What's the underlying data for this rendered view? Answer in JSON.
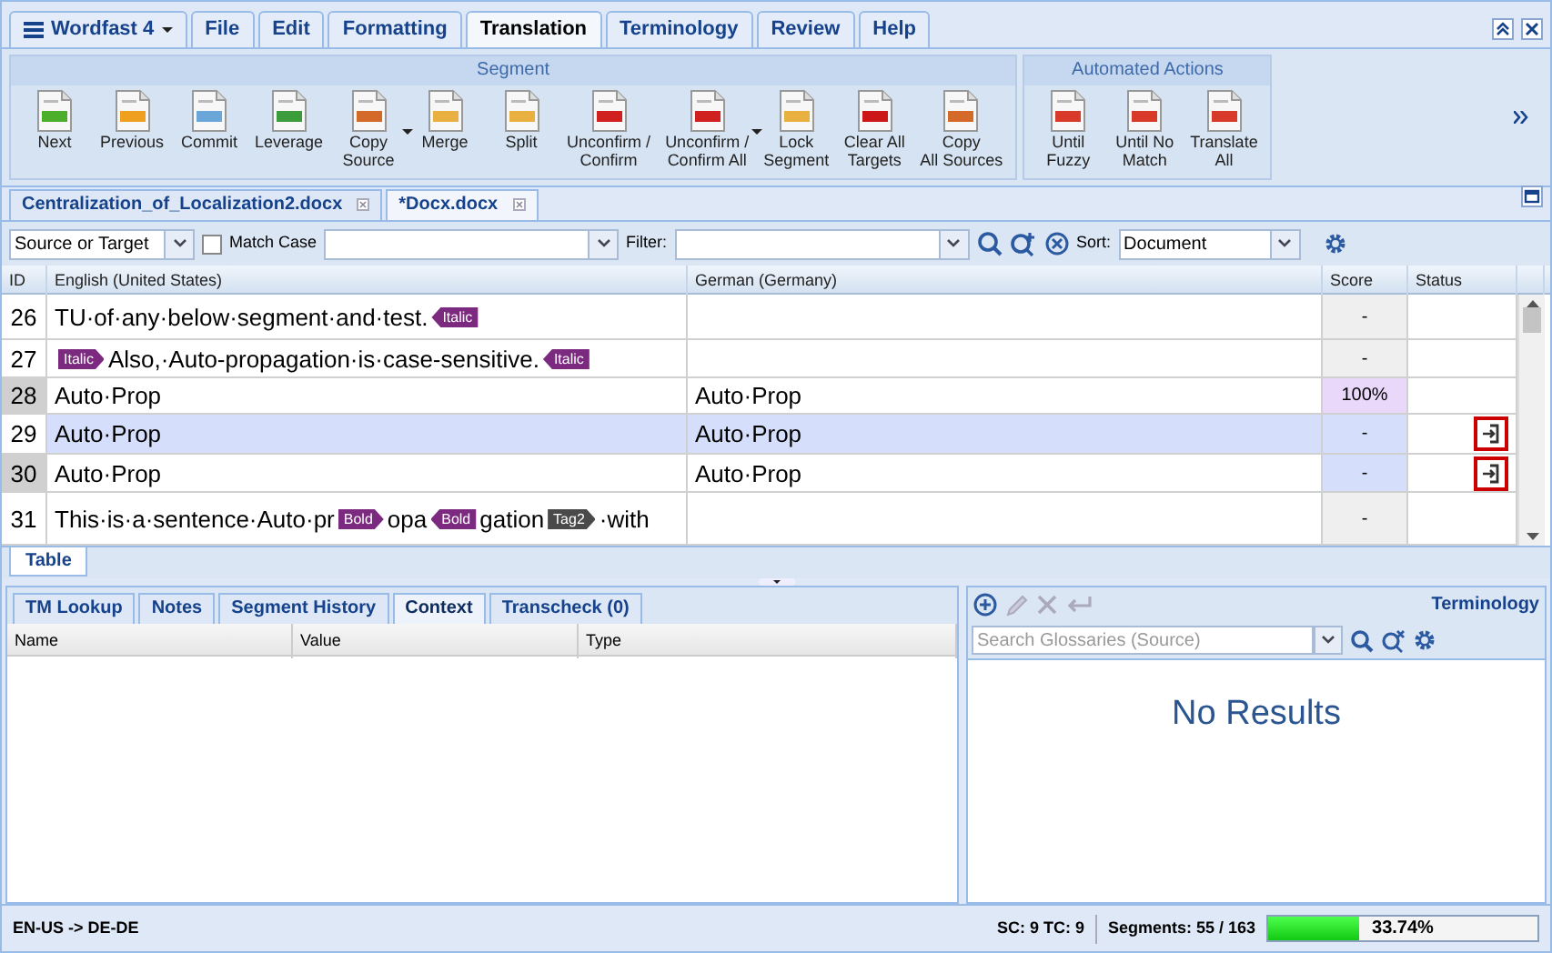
{
  "app_menu": {
    "label": "Wordfast 4"
  },
  "menu_tabs": [
    {
      "label": "File",
      "selected": false
    },
    {
      "label": "Edit",
      "selected": false
    },
    {
      "label": "Formatting",
      "selected": false
    },
    {
      "label": "Translation",
      "selected": true
    },
    {
      "label": "Terminology",
      "selected": false
    },
    {
      "label": "Review",
      "selected": false
    },
    {
      "label": "Help",
      "selected": false
    }
  ],
  "ribbon": {
    "groups": [
      {
        "title": "Segment",
        "buttons": [
          {
            "label": "Next",
            "dropdown": false
          },
          {
            "label": "Previous",
            "dropdown": false
          },
          {
            "label": "Commit",
            "dropdown": false
          },
          {
            "label": "Leverage",
            "dropdown": false
          },
          {
            "label": "Copy\nSource",
            "dropdown": true
          },
          {
            "label": "Merge",
            "dropdown": false
          },
          {
            "label": "Split",
            "dropdown": false
          },
          {
            "label": "Unconfirm /\nConfirm",
            "dropdown": false
          },
          {
            "label": "Unconfirm /\nConfirm All",
            "dropdown": true
          },
          {
            "label": "Lock\nSegment",
            "dropdown": false
          },
          {
            "label": "Clear All\nTargets",
            "dropdown": false
          },
          {
            "label": "Copy\nAll Sources",
            "dropdown": false
          }
        ]
      },
      {
        "title": "Automated Actions",
        "buttons": [
          {
            "label": "Until\nFuzzy",
            "dropdown": false
          },
          {
            "label": "Until No\nMatch",
            "dropdown": false
          },
          {
            "label": "Translate\nAll",
            "dropdown": false
          }
        ]
      }
    ]
  },
  "document_tabs": [
    {
      "label": "Centralization_of_Localization2.docx",
      "selected": false
    },
    {
      "label": "*Docx.docx",
      "selected": true
    }
  ],
  "search_bar": {
    "scope": "Source or Target",
    "match_case": false,
    "match_case_label": "Match Case",
    "filter_label": "Filter:",
    "sort_label": "Sort:",
    "sort_value": "Document"
  },
  "table": {
    "columns": [
      "ID",
      "English (United States)",
      "German (Germany)",
      "Score",
      "Status"
    ],
    "rows": [
      {
        "id": "26",
        "selected": false,
        "id_shaded": false,
        "source": [
          {
            "kind": "text",
            "text": "TU·of·any·below·segment·and·test."
          },
          {
            "kind": "close_tag",
            "text": "Italic",
            "color": "#7b2a7f"
          }
        ],
        "target": "",
        "score": {
          "text": "-",
          "color": "#efefef"
        },
        "status_icon": false
      },
      {
        "id": "27",
        "selected": false,
        "id_shaded": false,
        "source": [
          {
            "kind": "open_tag",
            "text": "Italic",
            "color": "#7b2a7f"
          },
          {
            "kind": "text",
            "text": "Also,·Auto-propagation·is·case-sensitive."
          },
          {
            "kind": "close_tag",
            "text": "Italic",
            "color": "#7b2a7f"
          }
        ],
        "target": "",
        "score": {
          "text": "-",
          "color": "#efefef"
        },
        "status_icon": false
      },
      {
        "id": "28",
        "selected": false,
        "id_shaded": true,
        "source": [
          {
            "kind": "text",
            "text": "Auto·Prop"
          }
        ],
        "target": "Auto·Prop",
        "score": {
          "text": "100%",
          "color": "#ead8fa"
        },
        "status_icon": false
      },
      {
        "id": "29",
        "selected": true,
        "id_shaded": false,
        "source": [
          {
            "kind": "text",
            "text": "Auto·Prop"
          }
        ],
        "target": "Auto·Prop",
        "score": {
          "text": "-",
          "color": "#d5defb"
        },
        "status_icon": true
      },
      {
        "id": "30",
        "selected": false,
        "id_shaded": true,
        "source": [
          {
            "kind": "text",
            "text": "Auto·Prop"
          }
        ],
        "target": "Auto·Prop",
        "score": {
          "text": "-",
          "color": "#d5defb"
        },
        "status_icon": true
      },
      {
        "id": "31",
        "selected": false,
        "id_shaded": false,
        "source": [
          {
            "kind": "text",
            "text": "This·is·a·sentence·Auto·pr"
          },
          {
            "kind": "open_tag",
            "text": "Bold",
            "color": "#7b2a7f"
          },
          {
            "kind": "text",
            "text": "opa"
          },
          {
            "kind": "close_tag",
            "text": "Bold",
            "color": "#7b2a7f"
          },
          {
            "kind": "text",
            "text": "gation"
          },
          {
            "kind": "open_tag",
            "text": "Tag2",
            "color": "#4a4a4a"
          },
          {
            "kind": "text",
            "text": "·with"
          }
        ],
        "target": "",
        "score": {
          "text": "-",
          "color": "#efefef"
        },
        "status_icon": false
      }
    ]
  },
  "view_tabs": [
    {
      "label": "Table",
      "selected": true
    }
  ],
  "bottom_tabs": [
    {
      "label": "TM Lookup",
      "selected": false
    },
    {
      "label": "Notes",
      "selected": false
    },
    {
      "label": "Segment History",
      "selected": false
    },
    {
      "label": "Context",
      "selected": true
    },
    {
      "label": "Transcheck (0)",
      "selected": false
    }
  ],
  "context_columns": [
    "Name",
    "Value",
    "Type"
  ],
  "terminology": {
    "title": "Terminology",
    "search_placeholder": "Search Glossaries (Source)",
    "message": "No Results"
  },
  "status_bar": {
    "languages": "EN-US -> DE-DE",
    "counts": "SC: 9 TC: 9",
    "segments": "Segments: 55 / 163",
    "progress": {
      "level": 0.3374,
      "reading": "33.74%"
    }
  }
}
